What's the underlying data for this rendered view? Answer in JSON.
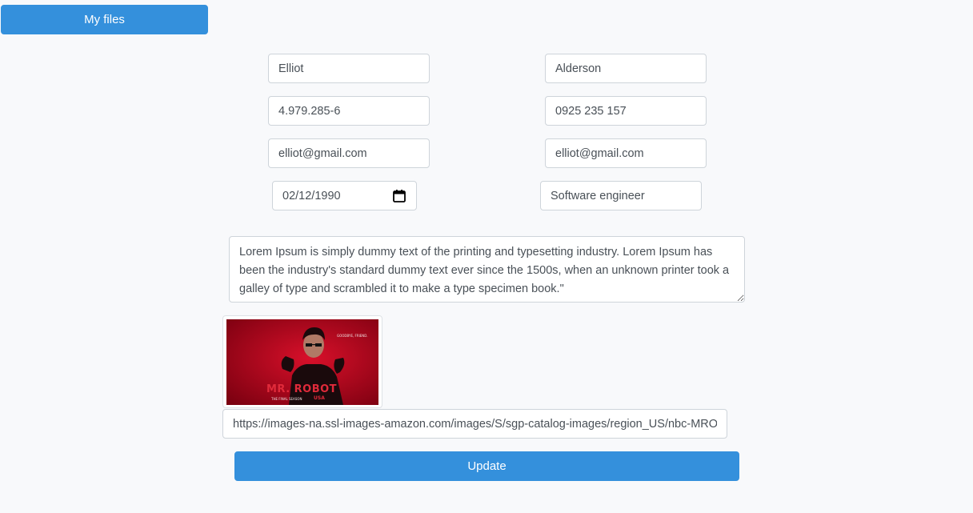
{
  "header": {
    "my_files_label": "My files"
  },
  "form": {
    "first_name": "Elliot",
    "last_name": "Alderson",
    "id_number": "4.979.285-6",
    "phone": "0925 235 157",
    "email": "elliot@gmail.com",
    "email_confirm": "elliot@gmail.com",
    "birth_date": "02/12/1990",
    "occupation": "Software engineer",
    "bio": "Lorem Ipsum is simply dummy text of the printing and typesetting industry. Lorem Ipsum has been the industry's standard dummy text ever since the 1500s, when an unknown printer took a galley of type and scrambled it to make a type specimen book.\"",
    "image_url": "https://images-na.ssl-images-amazon.com/images/S/sgp-catalog-images/region_US/nbc-MRO",
    "update_label": "Update"
  },
  "poster": {
    "title": "MR. ROBOT",
    "tagline": "GOODBYE, FRIEND.",
    "season": "THE FINAL SEASON",
    "network": "USA"
  },
  "colors": {
    "primary": "#3490dc",
    "page_bg": "#f8f9fb",
    "poster_red": "#c8102e"
  }
}
